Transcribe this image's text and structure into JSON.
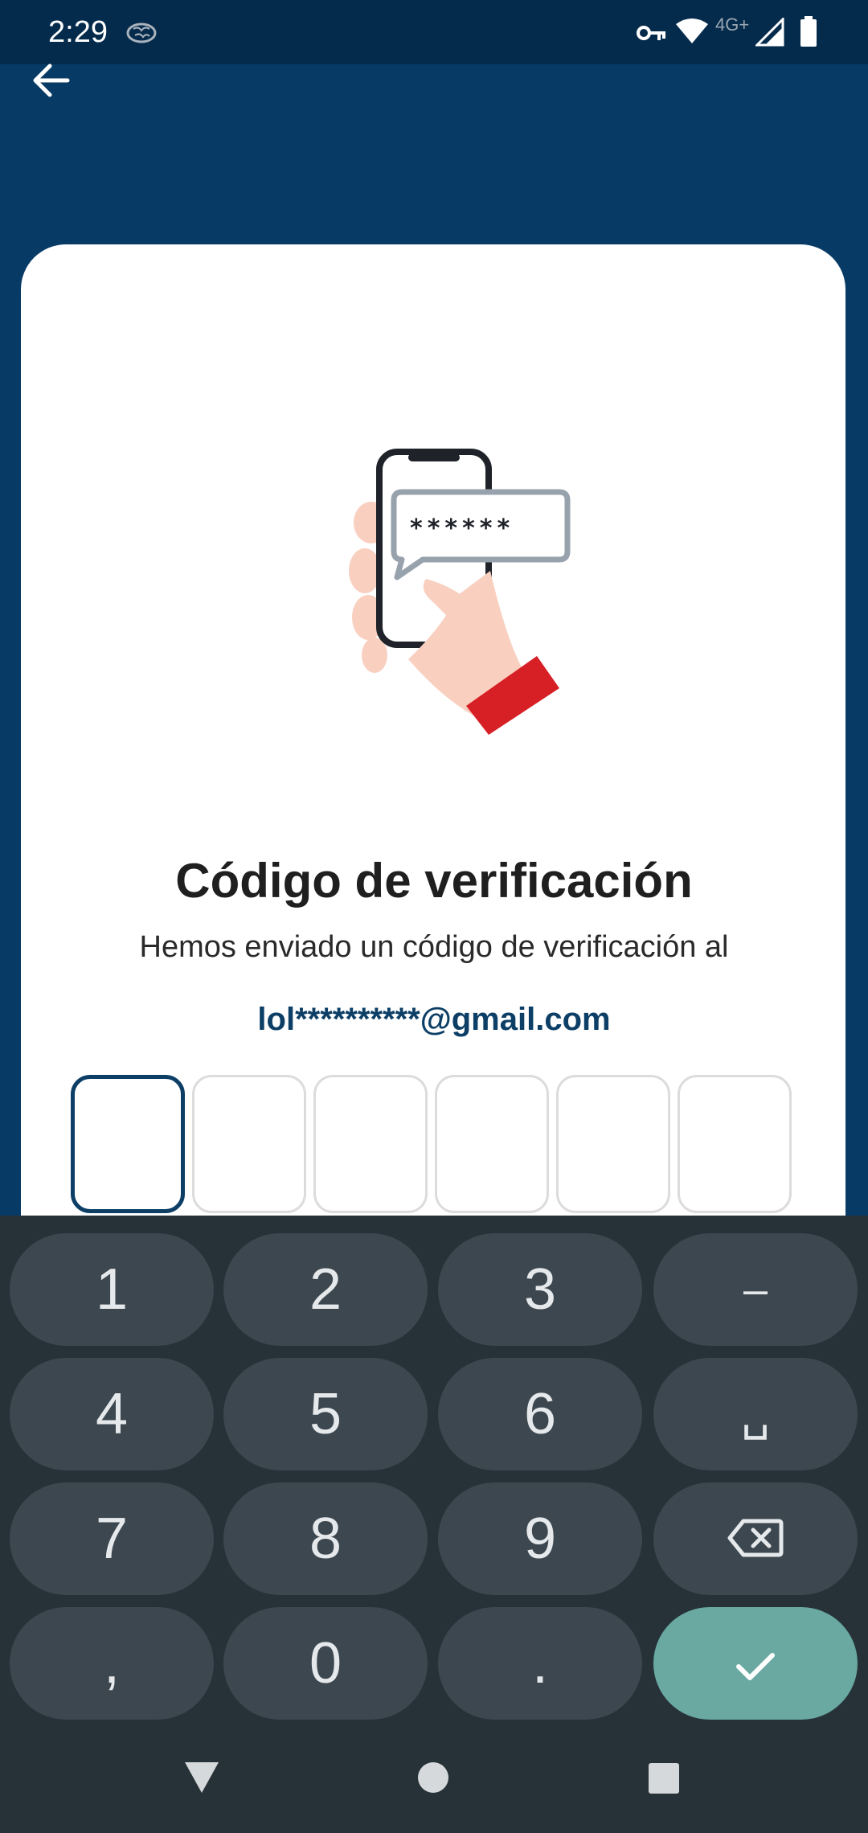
{
  "status_bar": {
    "time": "2:29",
    "network_label": "4G+",
    "icons": [
      "brain-icon",
      "key-icon",
      "wifi-icon",
      "signal-icon",
      "battery-icon"
    ]
  },
  "header": {
    "back_icon": "arrow-left-icon"
  },
  "main": {
    "title": "Código de verificación",
    "subtitle": "Hemos enviado un código de verificación al",
    "email": "lol**********@gmail.com",
    "illustration_mask": "******",
    "code_length": 6
  },
  "keyboard": {
    "row1": [
      "1",
      "2",
      "3",
      "–"
    ],
    "row2": [
      "4",
      "5",
      "6",
      "␣"
    ],
    "row3": [
      "7",
      "8",
      "9"
    ],
    "row4": [
      ",",
      "0",
      "."
    ],
    "backspace_icon": "backspace-icon",
    "enter_icon": "check-icon"
  },
  "nav": {
    "icons": [
      "back-triangle-icon",
      "home-circle-icon",
      "recents-square-icon"
    ]
  },
  "colors": {
    "primary": "#073b65",
    "status_bar": "#052b4c",
    "card": "#ffffff",
    "email_text": "#0d3f66",
    "keyboard_bg": "#263238",
    "key_bg": "#3c474f",
    "enter_key": "#6aa8a2",
    "accent_red": "#d71f26"
  }
}
